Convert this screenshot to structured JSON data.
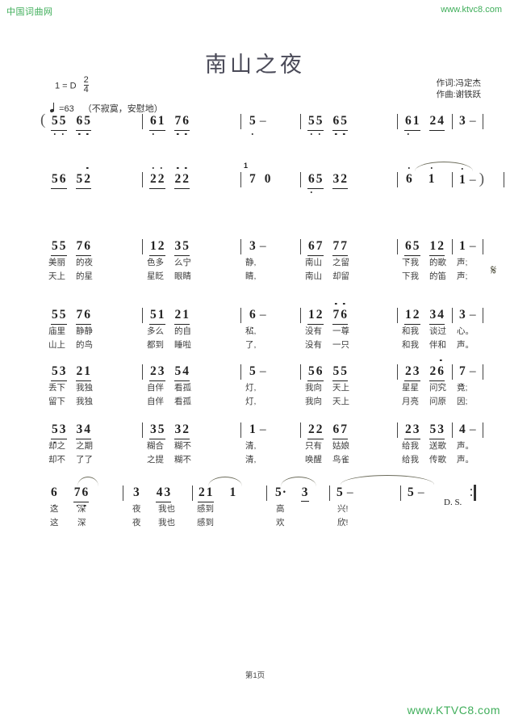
{
  "header": {
    "site_name": "中国词曲网",
    "site_url": "www.ktvc8.com"
  },
  "title": "南山之夜",
  "key_signature": "1 = D",
  "time_signature": {
    "numerator": "2",
    "denominator": "4"
  },
  "tempo": "=63",
  "expression": "（不寂寞，安慰地）",
  "credits": {
    "lyricist": "作词:冯定杰",
    "composer": "作曲:谢铁跃"
  },
  "markings": {
    "segno": "𝄋",
    "ds": "D. S.",
    "open_paren": "(",
    "close_paren": ")",
    "rest": "0",
    "grace_note_upper": "1"
  },
  "score": {
    "lines": [
      {
        "id": "line-1",
        "measures": [
          {
            "notes": "55  65"
          },
          {
            "notes": "61  76"
          },
          {
            "notes": "5  –"
          },
          {
            "notes": "55  65"
          },
          {
            "notes": "61  24"
          },
          {
            "notes": "3  –"
          }
        ]
      },
      {
        "id": "line-2",
        "measures": [
          {
            "notes": "56  52"
          },
          {
            "notes": "22  22"
          },
          {
            "notes": "7  0"
          },
          {
            "notes": "65  32"
          },
          {
            "notes": "6  1"
          },
          {
            "notes": "1  –  )"
          }
        ]
      },
      {
        "id": "line-3",
        "measures": [
          {
            "notes": "55  76"
          },
          {
            "notes": "12  35"
          },
          {
            "notes": "3  –"
          },
          {
            "notes": "67  77"
          },
          {
            "notes": "65  12"
          },
          {
            "notes": "1  –"
          }
        ],
        "lyrics_verse1": [
          "美丽",
          "的夜",
          "色多",
          "么宁",
          "静,",
          "",
          "南山",
          "之留",
          "下我",
          "的歌",
          "声;"
        ],
        "lyrics_verse2": [
          "天上",
          "的星",
          "星眨",
          "眼睛",
          "睛,",
          "",
          "南山",
          "却留",
          "下我",
          "的笛",
          "声;"
        ]
      },
      {
        "id": "line-4",
        "measures": [
          {
            "notes": "55  76"
          },
          {
            "notes": "51  21"
          },
          {
            "notes": "6  –"
          },
          {
            "notes": "12  76"
          },
          {
            "notes": "12  34"
          },
          {
            "notes": "3  –"
          }
        ],
        "lyrics_verse1": [
          "庙里",
          "静静",
          "多么",
          "的自",
          "私,",
          "",
          "没有",
          "一尊",
          "和我",
          "谈过",
          "心。"
        ],
        "lyrics_verse2": [
          "山上",
          "的鸟",
          "都到",
          "睡啦",
          "了,",
          "",
          "没有",
          "一只",
          "和我",
          "伴和",
          "声。"
        ]
      },
      {
        "id": "line-5",
        "measures": [
          {
            "notes": "53  21"
          },
          {
            "notes": "23  54"
          },
          {
            "notes": "5  –"
          },
          {
            "notes": "56  55"
          },
          {
            "notes": "23  26"
          },
          {
            "notes": "7  –"
          }
        ],
        "lyrics_verse1": [
          "丢下",
          "我独",
          "自伴",
          "看孤",
          "灯,",
          "",
          "我向",
          "天上",
          "星星",
          "问究",
          "竟;"
        ],
        "lyrics_verse2": [
          "留下",
          "我独",
          "自伴",
          "看孤",
          "灯,",
          "",
          "我向",
          "天上",
          "月亮",
          "问原",
          "因;"
        ]
      },
      {
        "id": "line-6",
        "measures": [
          {
            "notes": "53  34"
          },
          {
            "notes": "35  32"
          },
          {
            "notes": "1  –"
          },
          {
            "notes": "22  67"
          },
          {
            "notes": "23  53"
          },
          {
            "notes": "4  –"
          }
        ],
        "lyrics_verse1": [
          "却之",
          "之期",
          "糊合",
          "糊不",
          "清,",
          "",
          "只有",
          "姑娘",
          "给我",
          "送歌",
          "声。"
        ],
        "lyrics_verse2": [
          "却不",
          "了了",
          "之提",
          "糊不",
          "清,",
          "",
          "唤醒",
          "鸟雀",
          "给我",
          "传歌",
          "声。"
        ]
      },
      {
        "id": "line-7",
        "measures": [
          {
            "notes": "6  7  6"
          },
          {
            "notes": "3  43"
          },
          {
            "notes": "21  1"
          },
          {
            "notes": "5·  3"
          },
          {
            "notes": "5  –"
          },
          {
            "notes": "5  –"
          }
        ],
        "lyrics_verse1": [
          "这",
          "深",
          "夜",
          "我也",
          "感到",
          "高",
          "兴!"
        ],
        "lyrics_verse2": [
          "这",
          "深",
          "夜",
          "我也",
          "感到",
          "欢",
          "欣!"
        ]
      }
    ]
  },
  "page_number": "第1页",
  "footer_url": "www.KTVC8.com",
  "colors": {
    "brand_green": "#3fae5a",
    "title_gray": "#4a4a58",
    "note_black": "#222222",
    "lyric_gray": "#3d3d3d"
  }
}
